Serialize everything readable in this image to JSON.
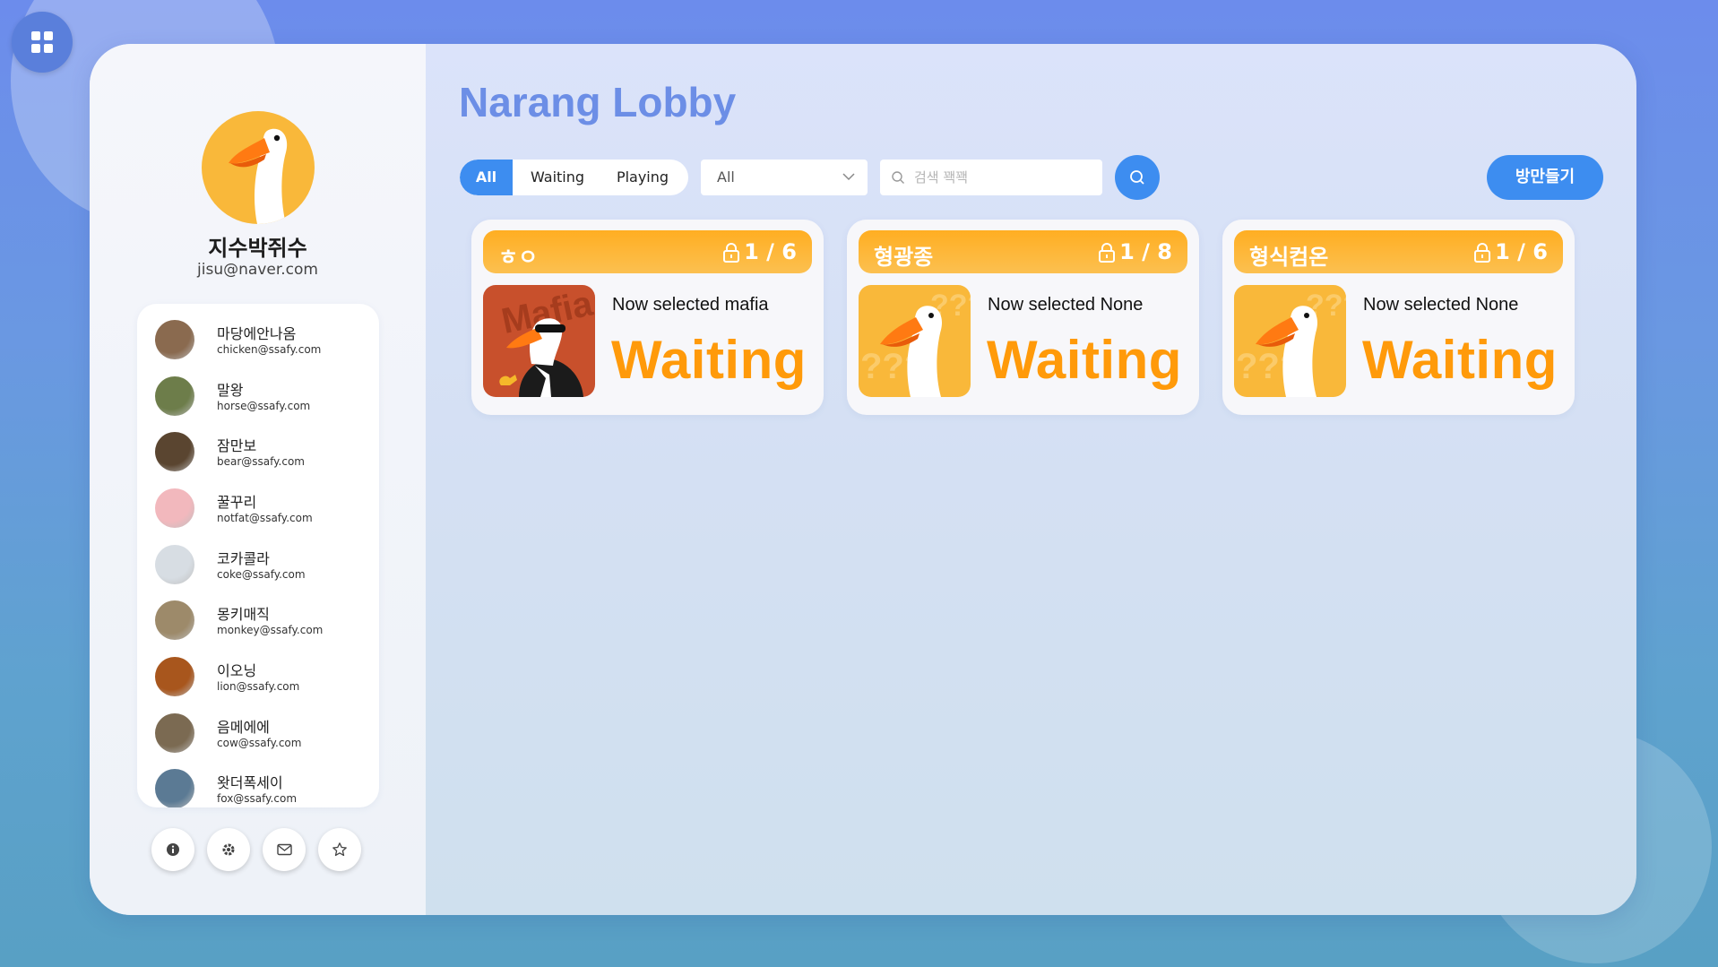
{
  "lobby": {
    "title": "Narang Lobby",
    "filters": [
      {
        "label": "All",
        "active": true
      },
      {
        "label": "Waiting",
        "active": false
      },
      {
        "label": "Playing",
        "active": false
      }
    ],
    "select_value": "All",
    "search_placeholder": "검색 꽥꽥",
    "create_room_label": "방만들기"
  },
  "profile": {
    "name": "지수박쥐수",
    "email": "jisu@naver.com"
  },
  "friends": [
    {
      "name": "마당에안나옴",
      "email": "chicken@ssafy.com",
      "color": "#8a6a4f"
    },
    {
      "name": "말왕",
      "email": "horse@ssafy.com",
      "color": "#6d7d4a"
    },
    {
      "name": "잠만보",
      "email": "bear@ssafy.com",
      "color": "#5a4530"
    },
    {
      "name": "꿀꾸리",
      "email": "notfat@ssafy.com",
      "color": "#f2b8bd"
    },
    {
      "name": "코카콜라",
      "email": "coke@ssafy.com",
      "color": "#d7dde3"
    },
    {
      "name": "몽키매직",
      "email": "monkey@ssafy.com",
      "color": "#9d8a6a"
    },
    {
      "name": "이오닝",
      "email": "lion@ssafy.com",
      "color": "#a8561d"
    },
    {
      "name": "음메에에",
      "email": "cow@ssafy.com",
      "color": "#7b6a52"
    },
    {
      "name": "왓더폭세이",
      "email": "fox@ssafy.com",
      "color": "#5b7a94"
    }
  ],
  "bottom_icons": [
    "info-icon",
    "gear-icon",
    "mail-icon",
    "star-icon"
  ],
  "rooms": [
    {
      "name": "ㅎㅇ",
      "count": "1 / 6",
      "selected": "Now selected mafia",
      "status": "Waiting",
      "thumb": "mafia"
    },
    {
      "name": "형광종",
      "count": "1 / 8",
      "selected": "Now selected None",
      "status": "Waiting",
      "thumb": "none"
    },
    {
      "name": "형식컴온",
      "count": "1 / 6",
      "selected": "Now selected None",
      "status": "Waiting",
      "thumb": "none"
    }
  ],
  "colors": {
    "accent": "#3d8df0",
    "title": "#6c8ee6",
    "room_header": "#ffae22",
    "status": "#ff9a0a",
    "goose_bg": "#f9b83a",
    "mafia_bg": "#c8502c"
  },
  "thumb_texts": {
    "mafia": "Mafia",
    "none": "???"
  }
}
